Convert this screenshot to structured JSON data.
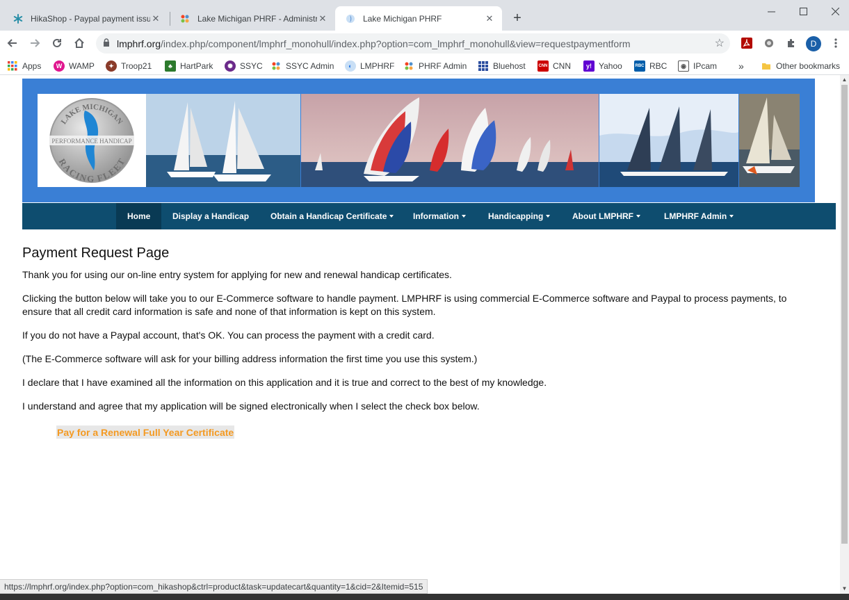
{
  "browser": {
    "tabs": [
      {
        "title": "HikaShop - Paypal payment issue",
        "icon": "hikashop-icon",
        "active": false
      },
      {
        "title": "Lake Michigan PHRF - Administra",
        "icon": "joomla-icon",
        "active": false
      },
      {
        "title": "Lake Michigan PHRF",
        "icon": "joomla-blue-icon",
        "active": true
      }
    ],
    "new_tab_label": "+",
    "url_host": "lmphrf.org",
    "url_path": "/index.php/component/lmphrf_monohull/index.php?option=com_lmphrf_monohull&view=requestpaymentform",
    "profile_initial": "D",
    "bookmarks": [
      {
        "label": "Apps",
        "icon": "apps-grid-icon"
      },
      {
        "label": "WAMP",
        "icon": "wamp-icon",
        "color": "#e0168f"
      },
      {
        "label": "Troop21",
        "icon": "troop-icon",
        "color": "#8a3b2a"
      },
      {
        "label": "HartPark",
        "icon": "hartpark-icon",
        "color": "#2d7a2d"
      },
      {
        "label": "SSYC",
        "icon": "ssyc-icon",
        "color": "#6b2a8a"
      },
      {
        "label": "SSYC Admin",
        "icon": "joomla-icon"
      },
      {
        "label": "LMPHRF",
        "icon": "lmphrf-icon",
        "color": "#1a73e8"
      },
      {
        "label": "PHRF Admin",
        "icon": "joomla-icon"
      },
      {
        "label": "Bluehost",
        "icon": "bluehost-icon",
        "color": "#2d4fa0"
      },
      {
        "label": "CNN",
        "icon": "cnn-icon",
        "color": "#cc0000"
      },
      {
        "label": "Yahoo",
        "icon": "yahoo-icon",
        "color": "#6001d2"
      },
      {
        "label": "RBC",
        "icon": "rbc-icon",
        "color": "#005daa"
      },
      {
        "label": "IPcam",
        "icon": "ipcam-icon",
        "color": "#555555"
      }
    ],
    "more_bookmarks": "»",
    "other_bookmarks": "Other bookmarks",
    "status_url": "https://lmphrf.org/index.php?option=com_hikashop&ctrl=product&task=updatecart&quantity=1&cid=2&Itemid=515"
  },
  "nav": {
    "items": [
      {
        "label": "Home",
        "dropdown": false,
        "active": true
      },
      {
        "label": "Display a Handicap",
        "dropdown": false,
        "active": false
      },
      {
        "label": "Obtain a Handicap Certificate",
        "dropdown": true,
        "active": false
      },
      {
        "label": "Information",
        "dropdown": true,
        "active": false
      },
      {
        "label": "Handicapping",
        "dropdown": true,
        "active": false
      },
      {
        "label": "About LMPHRF",
        "dropdown": true,
        "active": false
      },
      {
        "label": "LMPHRF Admin",
        "dropdown": true,
        "active": false
      }
    ]
  },
  "logo": {
    "top_text": "LAKE MICHIGAN",
    "band_text": "PERFORMANCE HANDICAP",
    "bottom_text": "RACING FLEET"
  },
  "main": {
    "title": "Payment Request Page",
    "paragraphs": [
      "Thank you for using our on-line entry system for applying for new and renewal handicap certificates.",
      "Clicking the button below will take you to our E-Commerce software to handle payment. LMPHRF is using commercial E-Commerce software and Paypal to process payments, to ensure that all credit card information is safe and none of that information is kept on this system.",
      "If you do not have a Paypal account, that's OK. You can process the payment with a credit card.",
      "(The E-Commerce software will ask for your billing address information the first time you use this system.)",
      "I declare that I have examined all the information on this application and it is true and correct to the best of my knowledge.",
      "I understand and agree that my application will be signed electronically when I select the check box below."
    ],
    "pay_button": "Pay for a Renewal Full Year Certificate"
  },
  "colors": {
    "banner": "#3a7fd5",
    "navbar": "#0e4d6f",
    "nav_active": "#093a54",
    "pay_text": "#f49a22"
  }
}
